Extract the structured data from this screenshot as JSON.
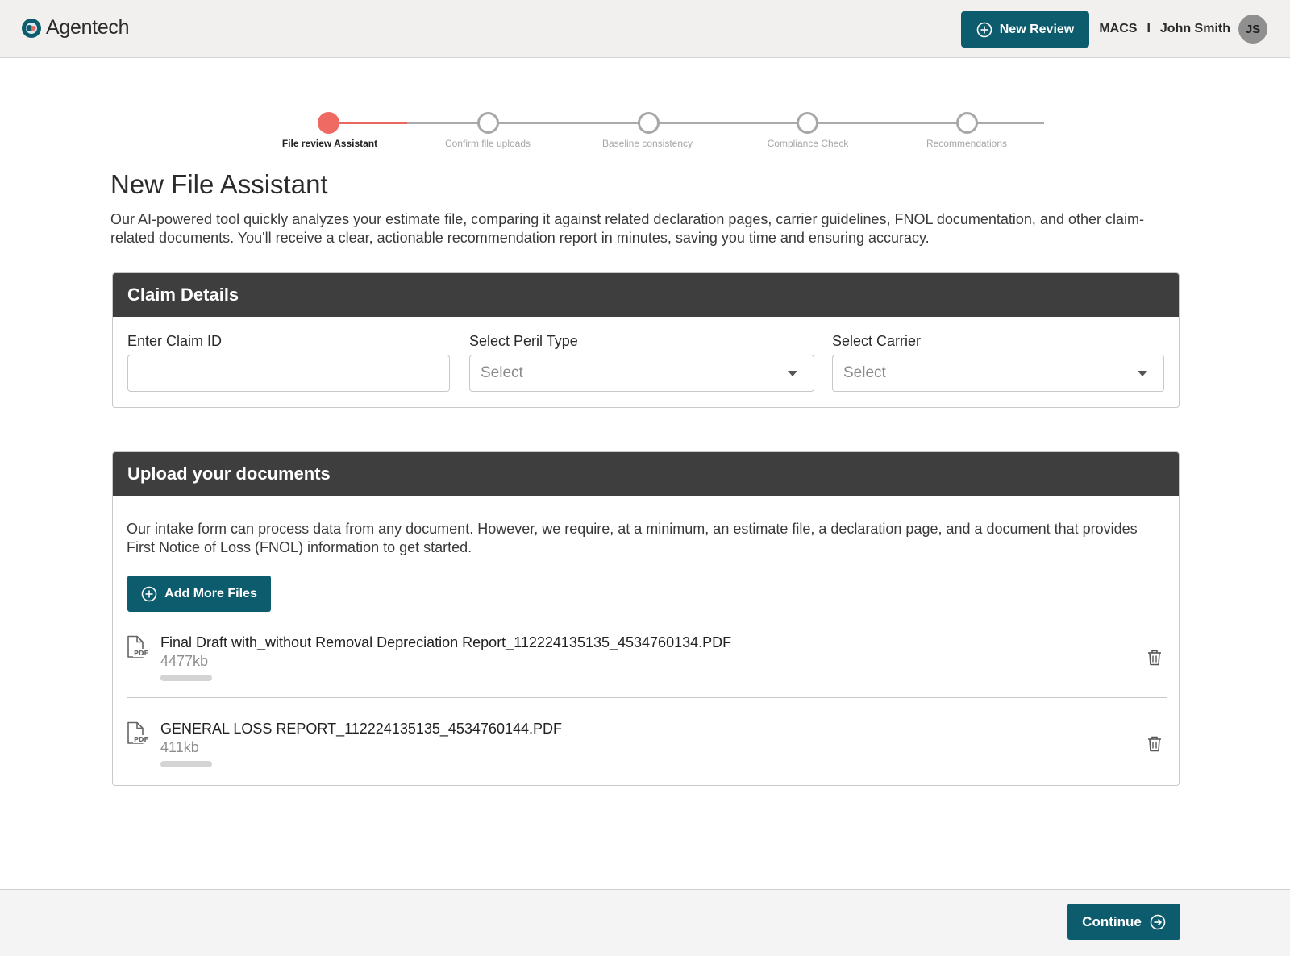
{
  "header": {
    "logo_text": "Agentech",
    "new_review_label": "New Review",
    "org": "MACS",
    "separator": "I",
    "user_name": "John Smith",
    "user_initials": "JS"
  },
  "stepper": {
    "steps": [
      {
        "label": "File review Assistant",
        "state": "active"
      },
      {
        "label": "Confirm file uploads",
        "state": "pending"
      },
      {
        "label": "Baseline consistency",
        "state": "pending"
      },
      {
        "label": "Compliance Check",
        "state": "pending"
      },
      {
        "label": "Recommendations",
        "state": "pending"
      }
    ]
  },
  "page": {
    "title": "New File Assistant",
    "intro": "Our AI-powered tool quickly analyzes your estimate file, comparing it against related declaration pages, carrier guidelines, FNOL documentation, and other claim-related documents. You'll receive a clear, actionable recommendation report in minutes, saving you time and ensuring accuracy."
  },
  "claim_details": {
    "title": "Claim Details",
    "claim_id_label": "Enter Claim ID",
    "claim_id_value": "",
    "peril_label": "Select Peril Type",
    "peril_value": "Select",
    "carrier_label": "Select Carrier",
    "carrier_value": "Select"
  },
  "upload": {
    "title": "Upload your documents",
    "description": "Our intake form can process data from any document. However, we require, at a minimum, an estimate file, a declaration page, and a document that provides First Notice of Loss (FNOL) information to get started.",
    "add_files_label": "Add More Files",
    "files": [
      {
        "name": "Final Draft with_without Removal Depreciation Report_112224135135_4534760134.PDF",
        "size": "4477kb",
        "progress": 1.0
      },
      {
        "name": "GENERAL LOSS REPORT_112224135135_4534760144.PDF",
        "size": "411kb",
        "progress": 1.0
      }
    ]
  },
  "footer": {
    "continue_label": "Continue"
  },
  "colors": {
    "primary": "#0d5c6d",
    "accent": "#ee6a62",
    "card_header": "#3e3e3e"
  }
}
